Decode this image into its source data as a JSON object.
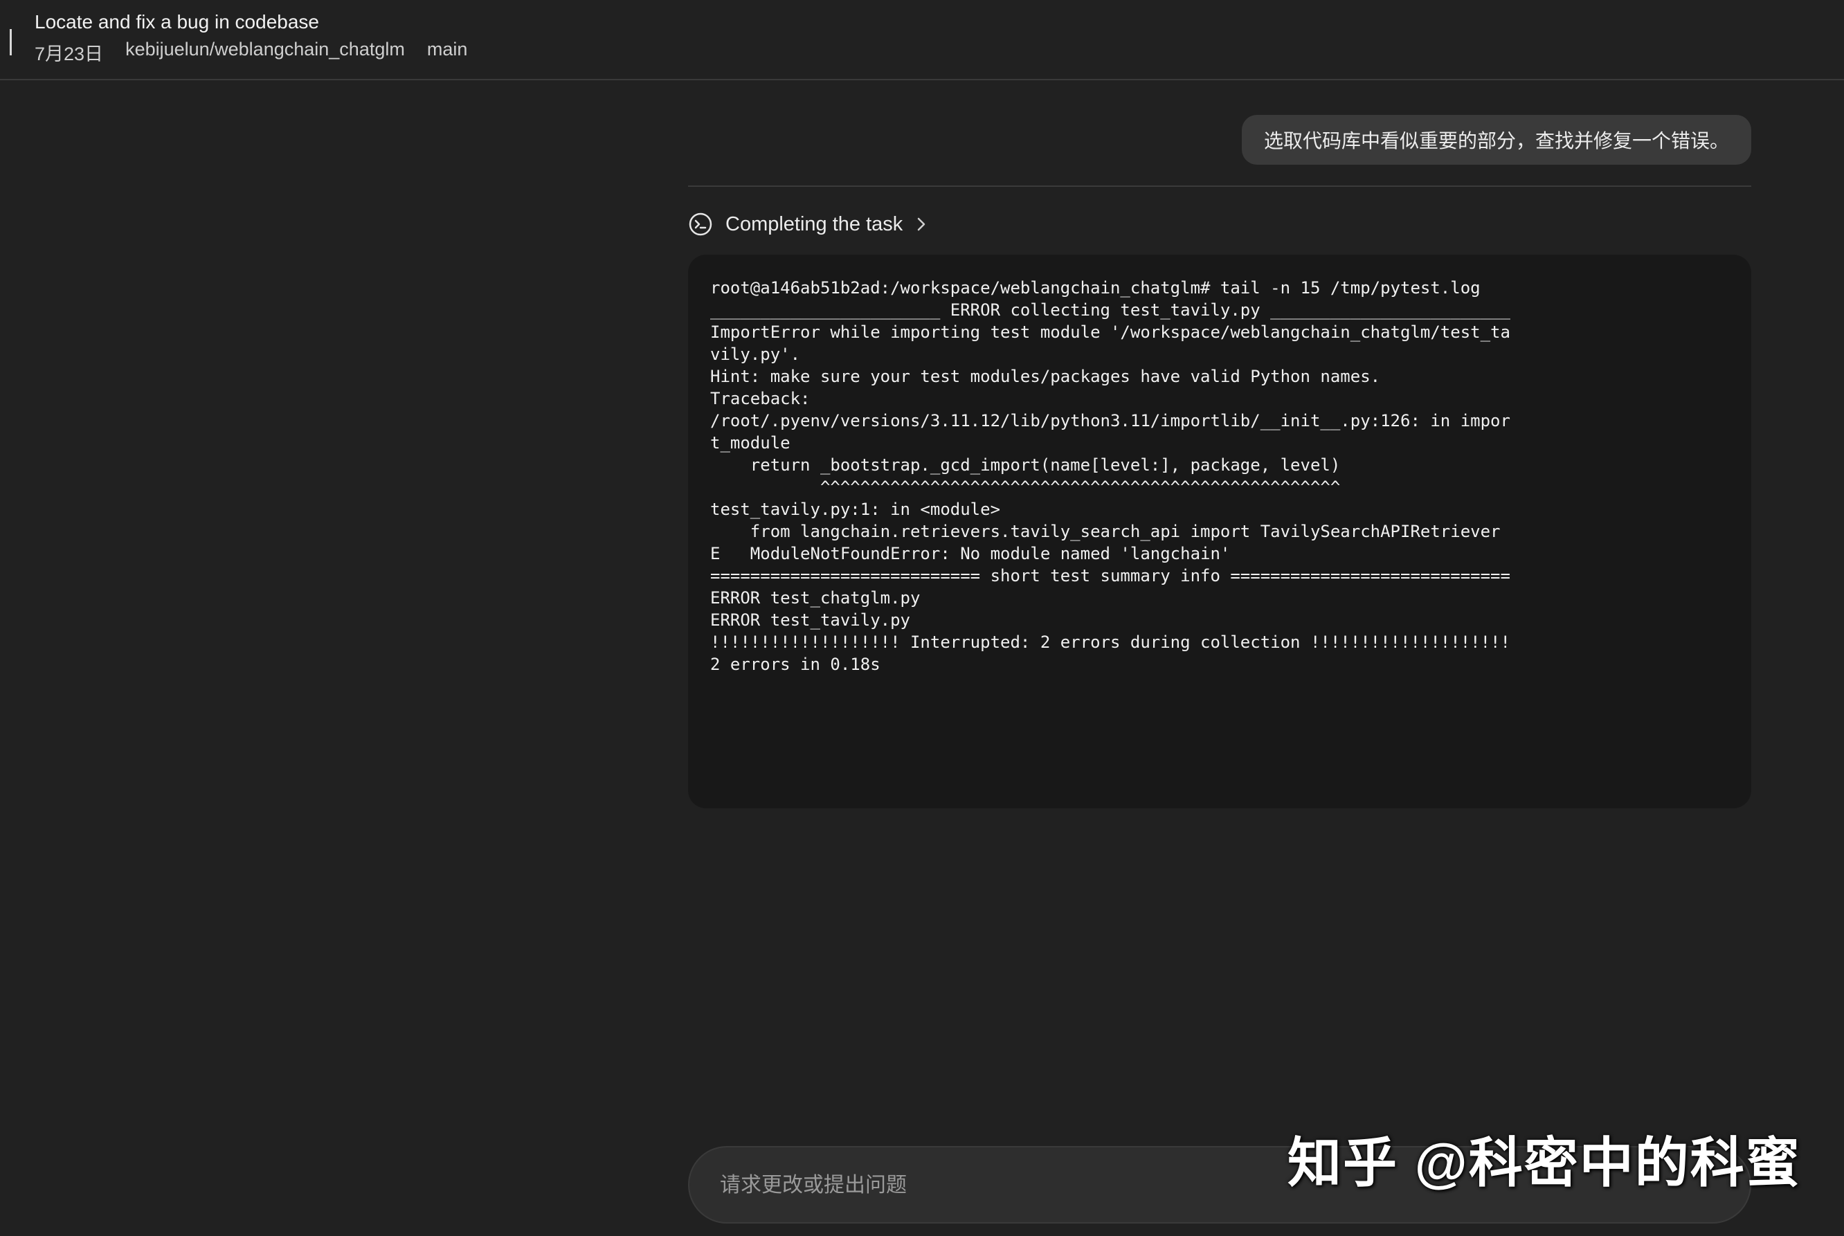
{
  "header": {
    "task_title": "Locate and fix a bug in codebase",
    "date": "7月23日",
    "repo": "kebijuelun/weblangchain_chatglm",
    "branch": "main"
  },
  "conversation": {
    "user_message": "选取代码库中看似重要的部分，查找并修复一个错误。",
    "status": {
      "icon": "terminal-circle-icon",
      "label": "Completing the task",
      "chevron_icon": "chevron-right-icon"
    },
    "terminal_lines": [
      "root@a146ab51b2ad:/workspace/weblangchain_chatglm# tail -n 15 /tmp/pytest.log",
      "_______________________ ERROR collecting test_tavily.py ________________________",
      "ImportError while importing test module '/workspace/weblangchain_chatglm/test_ta",
      "vily.py'.",
      "Hint: make sure your test modules/packages have valid Python names.",
      "Traceback:",
      "/root/.pyenv/versions/3.11.12/lib/python3.11/importlib/__init__.py:126: in impor",
      "t_module",
      "    return _bootstrap._gcd_import(name[level:], package, level)",
      "           ^^^^^^^^^^^^^^^^^^^^^^^^^^^^^^^^^^^^^^^^^^^^^^^^^^^^",
      "test_tavily.py:1: in <module>",
      "    from langchain.retrievers.tavily_search_api import TavilySearchAPIRetriever",
      "E   ModuleNotFoundError: No module named 'langchain'",
      "=========================== short test summary info ============================",
      "ERROR test_chatglm.py",
      "ERROR test_tavily.py",
      "!!!!!!!!!!!!!!!!!!! Interrupted: 2 errors during collection !!!!!!!!!!!!!!!!!!!!",
      "2 errors in 0.18s"
    ]
  },
  "composer": {
    "placeholder": "请求更改或提出问题"
  },
  "watermark": "知乎 @科密中的科蜜",
  "colors": {
    "background": "#212121",
    "terminal_bg": "#181818",
    "bubble_bg": "#3a3a3a"
  }
}
